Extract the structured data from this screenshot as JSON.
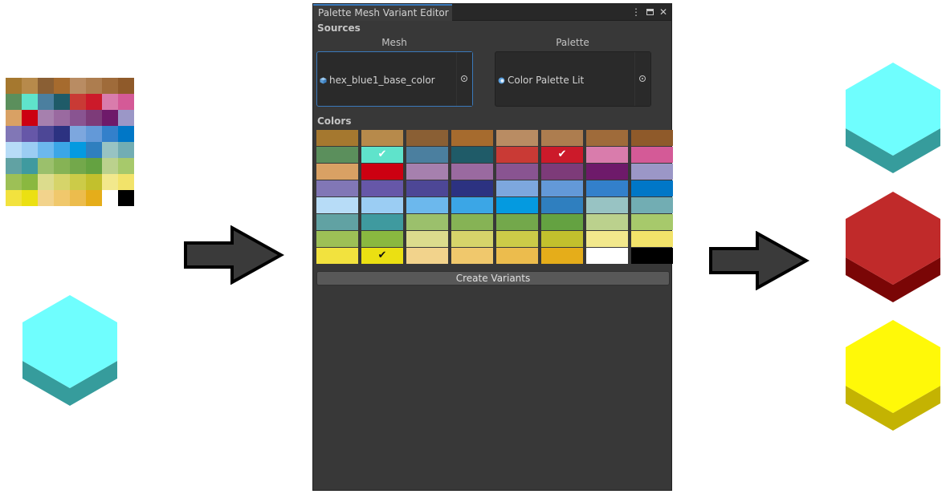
{
  "texture": {
    "colors": [
      "#a5782f",
      "#b78a4b",
      "#8a5f34",
      "#a66b2e",
      "#b98c63",
      "#ad7d4f",
      "#9f6b3a",
      "#8f5a2a",
      "#5b8f5c",
      "#5fe3cb",
      "#4b7f9f",
      "#1f5b68",
      "#c93a35",
      "#cc1a2a",
      "#d97cac",
      "#d45a97",
      "#d9a164",
      "#cc0011",
      "#a680ae",
      "#9a6aa0",
      "#895491",
      "#7d3b79",
      "#6e1a6a",
      "#9b97c7",
      "#8177b6",
      "#6657a8",
      "#4d4796",
      "#2c3281",
      "#7da7de",
      "#6399d8",
      "#3380cb",
      "#0077c7",
      "#b7dcf7",
      "#9bcdf3",
      "#6cb8ed",
      "#3ba6e6",
      "#049ae0",
      "#2f7fbf",
      "#98c3c3",
      "#72adb3",
      "#61a2a3",
      "#3f9a9f",
      "#9bc06c",
      "#86b355",
      "#73a84b",
      "#64a241",
      "#bbd18d",
      "#a7c96b",
      "#9dc056",
      "#8ab840",
      "#dcdc8d",
      "#d6d46a",
      "#cccb48",
      "#c2c02d",
      "#f2e88c",
      "#f2e36a",
      "#f2e23e",
      "#ebe012",
      "#f2d38c",
      "#f0c86c",
      "#ecbc4d",
      "#e5ad1a",
      "#ffffff",
      "#000000"
    ]
  },
  "editor": {
    "tab_title": "Palette Mesh Variant Editor",
    "sources_label": "Sources",
    "mesh_label": "Mesh",
    "palette_label": "Palette",
    "mesh_value": "hex_blue1_base_color",
    "palette_value": "Color Palette Lit",
    "colors_label": "Colors",
    "create_button": "Create Variants",
    "selected_indices": [
      9,
      13,
      57
    ],
    "check_glyph": "✔"
  },
  "colors": {
    "accent": "#3a79bb",
    "window_bg": "#383838",
    "field_bg": "#2a2a2a"
  },
  "hexes": {
    "input": {
      "top": "#6ffefe",
      "side": "#369c9c"
    },
    "outputs": [
      {
        "top": "#6ffefe",
        "side": "#369c9c"
      },
      {
        "top": "#c02a2a",
        "side": "#7a0606"
      },
      {
        "top": "#fff908",
        "side": "#c4b302"
      }
    ]
  },
  "icons": [
    "cube-icon",
    "palette-icon",
    "object-picker-icon",
    "kebab-menu-icon",
    "maximize-icon",
    "close-icon",
    "arrow-right-icon"
  ]
}
